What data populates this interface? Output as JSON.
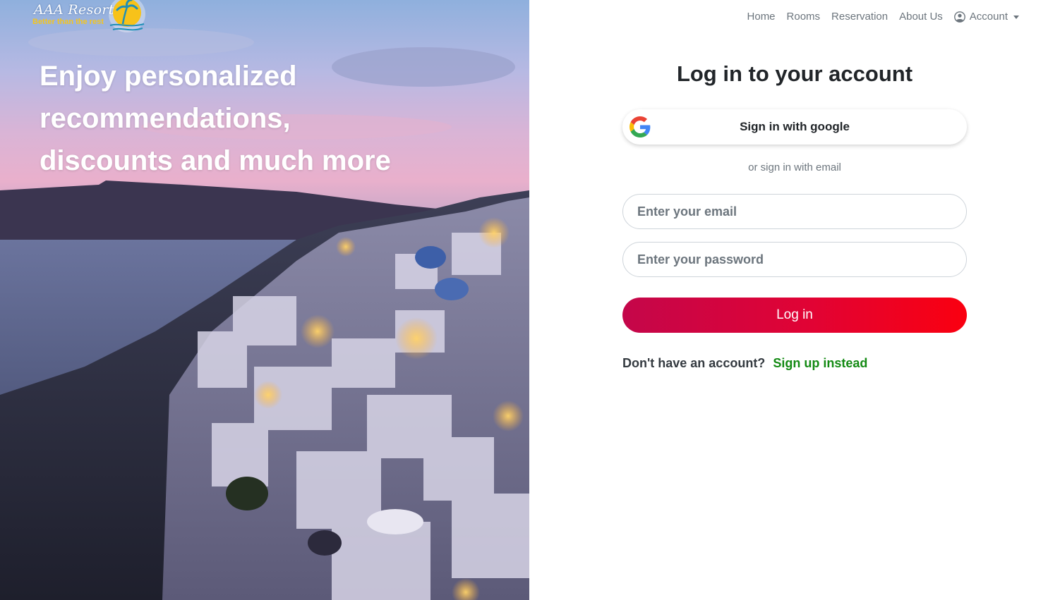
{
  "brand": {
    "name": "AAA Resorts",
    "tagline": "Better than the rest"
  },
  "hero": {
    "headline_lines": [
      "Enjoy personalized",
      "recommendations,",
      "discounts and much more"
    ]
  },
  "nav": {
    "items": [
      {
        "label": "Home"
      },
      {
        "label": "Rooms"
      },
      {
        "label": "Reservation"
      },
      {
        "label": "About Us"
      }
    ],
    "account_label": "Account"
  },
  "login": {
    "title": "Log in to your account",
    "google_button": "Sign in with google",
    "divider_text": "or sign in with email",
    "email_placeholder": "Enter your email",
    "email_value": "",
    "password_placeholder": "Enter your password",
    "password_value": "",
    "submit_label": "Log in",
    "signup_prompt": "Don't have an account?",
    "signup_link": "Sign up instead"
  },
  "colors": {
    "primary_gradient_start": "#c4064a",
    "primary_gradient_end": "#fa0010",
    "signup_link": "#138a13",
    "tagline": "#f4c51e"
  },
  "icons": {
    "google": "google-g-icon",
    "account": "user-circle-icon",
    "logo": "sun-palm-logo-icon"
  }
}
